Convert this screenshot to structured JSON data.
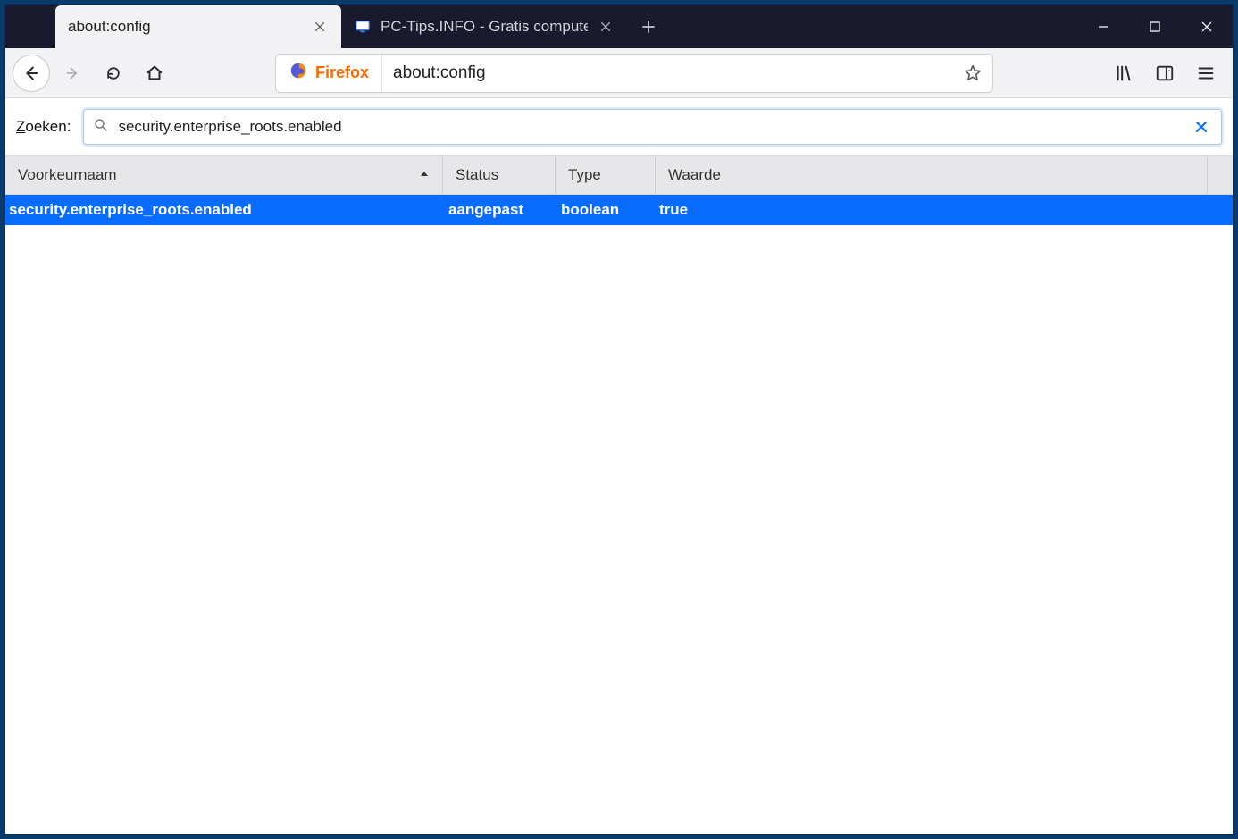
{
  "window": {
    "tabs": [
      {
        "label": "about:config",
        "active": true
      },
      {
        "label": "PC-Tips.INFO - Gratis compute",
        "active": false
      }
    ]
  },
  "toolbar": {
    "identity_brand": "Firefox",
    "url_text": "about:config"
  },
  "search": {
    "label_prefix": "Z",
    "label_rest": "oeken:",
    "value": "security.enterprise_roots.enabled"
  },
  "table": {
    "headers": {
      "name": "Voorkeurnaam",
      "status": "Status",
      "type": "Type",
      "value": "Waarde"
    },
    "rows": [
      {
        "name": "security.enterprise_roots.enabled",
        "status": "aangepast",
        "type": "boolean",
        "value": "true",
        "selected": true
      }
    ]
  }
}
